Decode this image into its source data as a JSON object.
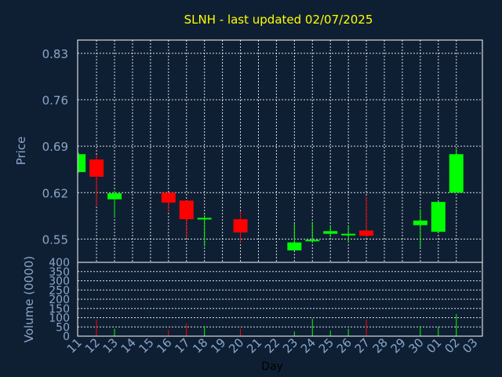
{
  "title": "SLNH - last updated 02/07/2025",
  "colors": {
    "background": "#0f1f33",
    "up": "#00ff00",
    "down": "#ff0000",
    "title": "#ffff00",
    "tick": "#8aa6c8"
  },
  "chart_data": {
    "type": "candlestick",
    "grid": true,
    "price_axis": {
      "label": "Price",
      "ylim": [
        0.515,
        0.85
      ],
      "ticks": [
        "0.83",
        "0.76",
        "0.69",
        "0.62",
        "0.55"
      ],
      "tick_values": [
        0.83,
        0.76,
        0.69,
        0.62,
        0.55
      ]
    },
    "volume_axis": {
      "label": "Volume (0000)",
      "ylim": [
        0,
        400
      ],
      "ticks": [
        "400",
        "350",
        "300",
        "250",
        "200",
        "150",
        "100",
        "50",
        "0"
      ],
      "tick_values": [
        400,
        350,
        300,
        250,
        200,
        150,
        100,
        50,
        0
      ]
    },
    "x_axis": {
      "label": "Day",
      "ticks": [
        "11",
        "12",
        "13",
        "14",
        "15",
        "16",
        "17",
        "18",
        "19",
        "20",
        "21",
        "22",
        "23",
        "24",
        "25",
        "26",
        "27",
        "28",
        "29",
        "30",
        "01",
        "02",
        "03"
      ]
    },
    "candles": [
      {
        "day": "11",
        "open": 0.651,
        "high": 0.68,
        "low": 0.65,
        "close": 0.678,
        "volume": 0
      },
      {
        "day": "12",
        "open": 0.67,
        "high": 0.677,
        "low": 0.6,
        "close": 0.644,
        "volume": 90
      },
      {
        "day": "13",
        "open": 0.61,
        "high": 0.623,
        "low": 0.583,
        "close": 0.619,
        "volume": 40
      },
      {
        "day": "16",
        "open": 0.62,
        "high": 0.62,
        "low": 0.59,
        "close": 0.605,
        "volume": 35
      },
      {
        "day": "17",
        "open": 0.608,
        "high": 0.608,
        "low": 0.552,
        "close": 0.58,
        "volume": 70
      },
      {
        "day": "18",
        "open": 0.58,
        "high": 0.586,
        "low": 0.539,
        "close": 0.582,
        "volume": 55
      },
      {
        "day": "20",
        "open": 0.58,
        "high": 0.592,
        "low": 0.545,
        "close": 0.56,
        "volume": 40
      },
      {
        "day": "23",
        "open": 0.533,
        "high": 0.574,
        "low": 0.533,
        "close": 0.545,
        "volume": 25
      },
      {
        "day": "24",
        "open": 0.548,
        "high": 0.576,
        "low": 0.546,
        "close": 0.549,
        "volume": 95
      },
      {
        "day": "25",
        "open": 0.558,
        "high": 0.571,
        "low": 0.553,
        "close": 0.562,
        "volume": 30
      },
      {
        "day": "26",
        "open": 0.556,
        "high": 0.571,
        "low": 0.545,
        "close": 0.558,
        "volume": 40
      },
      {
        "day": "27",
        "open": 0.563,
        "high": 0.614,
        "low": 0.553,
        "close": 0.555,
        "volume": 90
      },
      {
        "day": "30",
        "open": 0.571,
        "high": 0.595,
        "low": 0.537,
        "close": 0.578,
        "volume": 55
      },
      {
        "day": "01",
        "open": 0.561,
        "high": 0.606,
        "low": 0.56,
        "close": 0.606,
        "volume": 50
      },
      {
        "day": "02",
        "open": 0.62,
        "high": 0.686,
        "low": 0.62,
        "close": 0.678,
        "volume": 120
      }
    ]
  }
}
